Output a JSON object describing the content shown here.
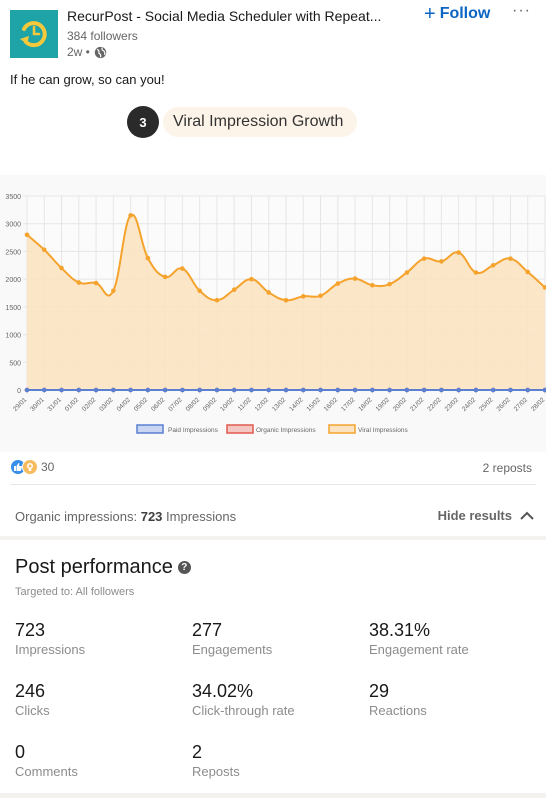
{
  "header": {
    "company_name": "RecurPost - Social Media Scheduler with Repeat...",
    "followers": "384 followers",
    "time": "2w •",
    "follow_label": "Follow",
    "more_label": "···",
    "logo_icon": "clock-history-icon",
    "visibility_icon": "globe-icon"
  },
  "post": {
    "text": "If he can grow, so can you!",
    "step_number": "3",
    "step_title": "Viral Impression Growth"
  },
  "chart_data": {
    "type": "line",
    "title": "",
    "xlabel": "",
    "ylabel": "",
    "ylim": [
      0,
      3500
    ],
    "yticks": [
      0,
      500,
      1000,
      1500,
      2000,
      2500,
      3000,
      3500
    ],
    "grid": true,
    "legend_position": "bottom",
    "categories": [
      "29/01",
      "30/01",
      "31/01",
      "01/02",
      "02/02",
      "03/02",
      "04/02",
      "05/02",
      "06/02",
      "07/02",
      "08/02",
      "09/02",
      "10/02",
      "11/02",
      "12/02",
      "13/02",
      "14/02",
      "15/02",
      "16/02",
      "17/02",
      "18/02",
      "19/02",
      "20/02",
      "21/02",
      "22/02",
      "23/02",
      "24/02",
      "25/02",
      "26/02",
      "27/02",
      "28/02"
    ],
    "series": [
      {
        "name": "Paid Impressions",
        "color": "#5b7fd1",
        "fill": "#c9d6f2",
        "values": [
          0,
          0,
          0,
          0,
          0,
          0,
          0,
          0,
          0,
          0,
          0,
          0,
          0,
          0,
          0,
          0,
          0,
          0,
          0,
          0,
          0,
          0,
          0,
          0,
          0,
          0,
          0,
          0,
          0,
          0,
          0
        ]
      },
      {
        "name": "Organic Impressions",
        "color": "#e0584d",
        "fill": "#f5c7c3",
        "values": [
          0,
          0,
          0,
          0,
          0,
          0,
          0,
          0,
          0,
          0,
          0,
          0,
          0,
          0,
          0,
          0,
          0,
          0,
          0,
          0,
          0,
          0,
          0,
          0,
          0,
          0,
          0,
          0,
          0,
          0,
          0
        ]
      },
      {
        "name": "Viral Impressions",
        "color": "#f5a32d",
        "fill": "#fbe3c2",
        "values": [
          2800,
          2530,
          2200,
          1940,
          1930,
          1790,
          3150,
          2380,
          2040,
          2190,
          1790,
          1620,
          1810,
          2000,
          1760,
          1620,
          1690,
          1700,
          1920,
          2010,
          1890,
          1910,
          2120,
          2370,
          2320,
          2480,
          2120,
          2250,
          2370,
          2130,
          1850
        ]
      }
    ]
  },
  "social": {
    "reaction_count": "30",
    "reposts": "2 reposts",
    "reaction_icons": [
      "like-icon",
      "insightful-icon"
    ]
  },
  "organic": {
    "prefix": "Organic impressions: ",
    "value": "723",
    "suffix": " Impressions",
    "hide_label": "Hide results"
  },
  "performance": {
    "title": "Post performance",
    "targeted": "Targeted to: All followers",
    "metrics": [
      {
        "value": "723",
        "label": "Impressions"
      },
      {
        "value": "277",
        "label": "Engagements"
      },
      {
        "value": "38.31%",
        "label": "Engagement rate"
      },
      {
        "value": "246",
        "label": "Clicks"
      },
      {
        "value": "34.02%",
        "label": "Click-through rate"
      },
      {
        "value": "29",
        "label": "Reactions"
      },
      {
        "value": "0",
        "label": "Comments"
      },
      {
        "value": "2",
        "label": "Reposts"
      }
    ]
  }
}
